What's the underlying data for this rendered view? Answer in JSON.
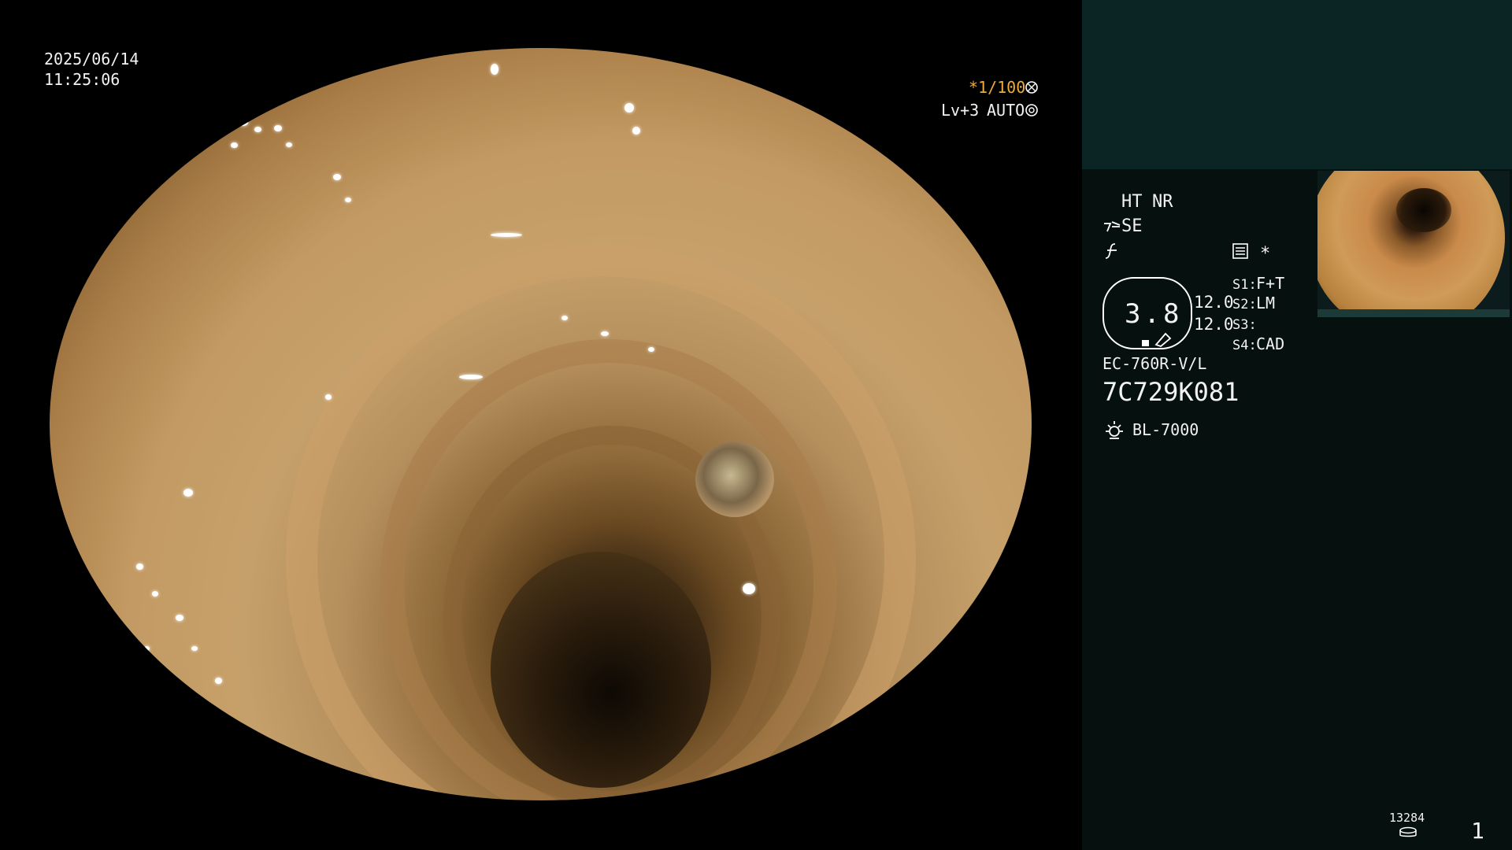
{
  "datetime": {
    "date": "2025/06/14",
    "time": "11:25:06"
  },
  "exposure": {
    "shutter": "*1/100",
    "shutter_icon": "shutter-icon",
    "level": "Lv+3",
    "mode": "AUTO",
    "mode_icon": "iris-icon"
  },
  "image_modes": {
    "ht": "HT",
    "nr": "NR",
    "se_icon": "se-icon",
    "se": "SE",
    "f_icon": "f-icon"
  },
  "settings": {
    "memo_icon": "memo-icon",
    "asterisk": "*"
  },
  "gauge": {
    "value": "3.8"
  },
  "readings": [
    "12.0",
    "12.0"
  ],
  "switches": [
    {
      "key": "S1:",
      "value": "F+T"
    },
    {
      "key": "S2:",
      "value": "LM"
    },
    {
      "key": "S3:",
      "value": ""
    },
    {
      "key": "S4:",
      "value": "CAD"
    }
  ],
  "scope": {
    "model": "EC-760R-V/L",
    "serial": "7C729K081"
  },
  "light_source": {
    "icon": "lamp-icon",
    "name": "BL-7000"
  },
  "storage": {
    "count": "13284",
    "icon": "disk-icon"
  },
  "page_number": "1",
  "colors": {
    "panel_bg": "#06100f",
    "panel_top": "#0b2524",
    "accent_orange": "#f0a93c"
  }
}
